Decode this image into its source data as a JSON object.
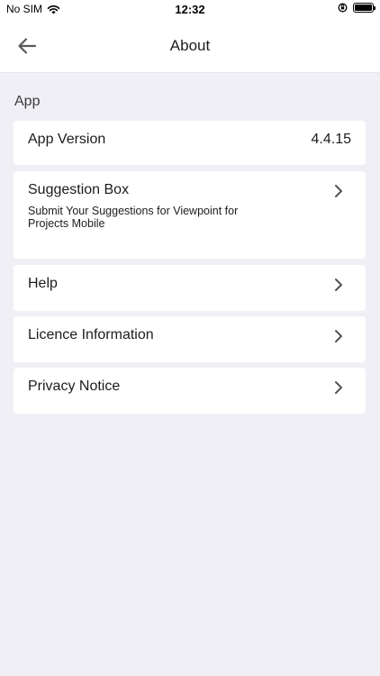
{
  "status_bar": {
    "carrier": "No SIM",
    "time": "12:32",
    "icons": [
      "wifi-icon",
      "rotation-lock-icon",
      "battery-icon"
    ]
  },
  "nav": {
    "title": "About",
    "back_icon": "arrow-left-icon"
  },
  "section": {
    "header": "App"
  },
  "rows": {
    "app_version": {
      "label": "App Version",
      "value": "4.4.15"
    },
    "suggestion_box": {
      "label": "Suggestion Box",
      "subtitle": "Submit Your Suggestions for Viewpoint for Projects Mobile"
    },
    "help": {
      "label": "Help"
    },
    "licence": {
      "label": "Licence Information"
    },
    "privacy": {
      "label": "Privacy Notice"
    }
  }
}
